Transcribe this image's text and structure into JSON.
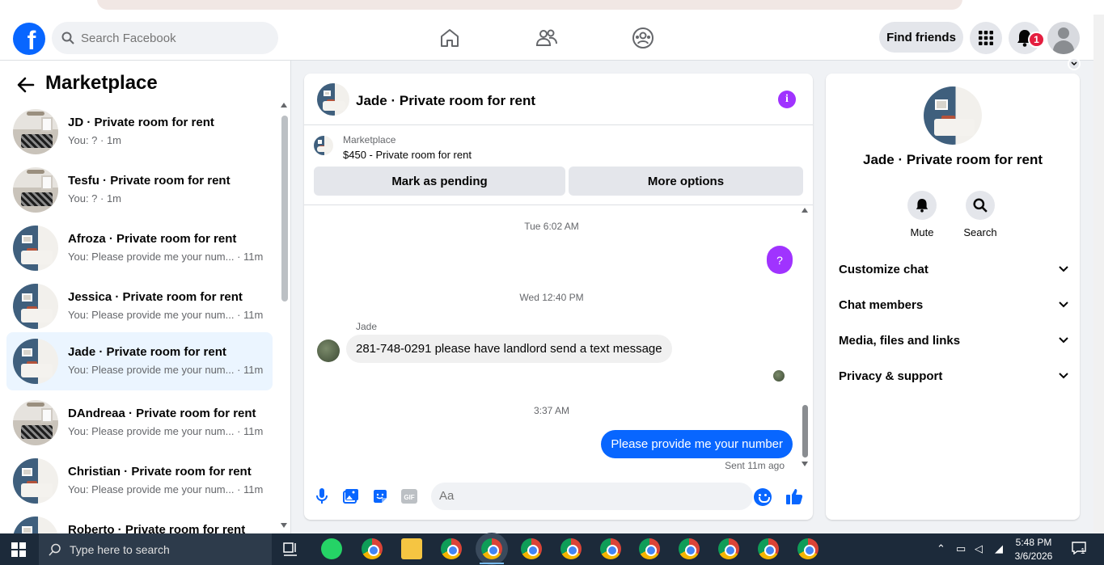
{
  "nav": {
    "logo_letter": "f",
    "search_placeholder": "Search Facebook",
    "find_friends_label": "Find friends",
    "notification_count": "1",
    "icons": [
      "home-icon",
      "friends-icon",
      "groups-icon",
      "menu-grid-icon",
      "bell-icon",
      "profile-avatar"
    ]
  },
  "sidebar": {
    "title": "Marketplace",
    "conversations": [
      {
        "name": "JD · Private room for rent",
        "preview": "You: ? · 1m"
      },
      {
        "name": "Tesfu · Private room for rent",
        "preview": "You: ? · 1m"
      },
      {
        "name": "Afroza · Private room for rent",
        "preview": "You: Please provide me your num... · 11m"
      },
      {
        "name": "Jessica · Private room for rent",
        "preview": "You: Please provide me your num... · 11m"
      },
      {
        "name": "Jade · Private room for rent",
        "preview": "You: Please provide me your num... · 11m",
        "active": true
      },
      {
        "name": "DAndreaa · Private room for rent",
        "preview": "You: Please provide me your num... · 11m"
      },
      {
        "name": "Christian · Private room for rent",
        "preview": "You: Please provide me your num... · 11m"
      },
      {
        "name": "Roberto · Private room for rent",
        "preview": ""
      }
    ]
  },
  "chat": {
    "title": "Jade · Private room for rent",
    "listing_source": "Marketplace",
    "listing_summary": "$450 - Private room for rent",
    "mark_pending_label": "Mark as pending",
    "more_options_label": "More options",
    "messages": {
      "ts1": "Tue 6:02 AM",
      "out1": "?",
      "ts2": "Wed 12:40 PM",
      "sender": "Jade",
      "in1": "281-748-0291 please have landlord send a text message",
      "ts3": "3:37 AM",
      "out2": "Please provide me your number",
      "status": "Sent 11m ago"
    },
    "composer_placeholder": "Aa",
    "composer_icons": [
      "microphone-icon",
      "photo-icon",
      "sticker-icon",
      "gif-icon",
      "emoji-icon",
      "thumbs-up-icon"
    ]
  },
  "details": {
    "title": "Jade · Private room for rent",
    "mute_label": "Mute",
    "search_label": "Search",
    "sections": [
      "Customize chat",
      "Chat members",
      "Media, files and links",
      "Privacy & support"
    ]
  },
  "taskbar": {
    "search_placeholder": "Type here to search",
    "time": "5:48 PM",
    "date": "3/6/2026",
    "notification_count": "1"
  },
  "colors": {
    "brand_blue": "#0866ff",
    "accent_purple": "#a033ff",
    "active_row": "#ebf5ff",
    "badge_red": "#e41e3f"
  }
}
